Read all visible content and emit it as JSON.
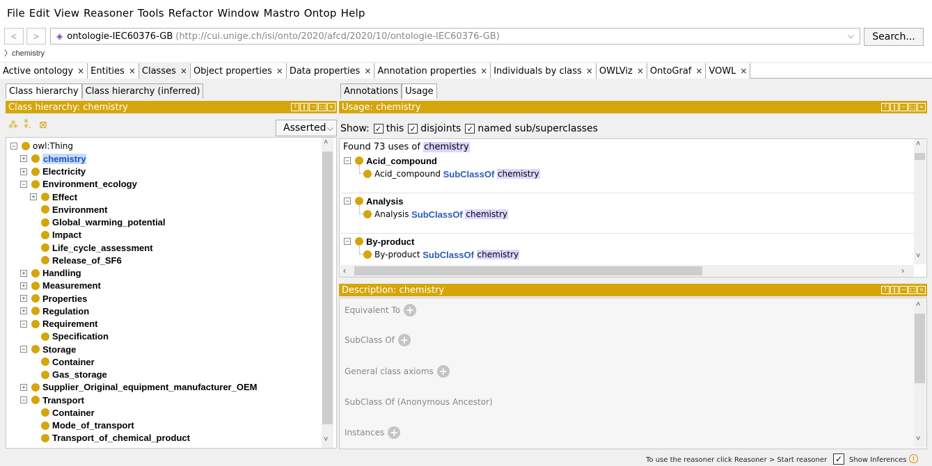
{
  "menu": [
    "File",
    "Edit",
    "View",
    "Reasoner",
    "Tools",
    "Refactor",
    "Window",
    "Mastro",
    "Ontop",
    "Help"
  ],
  "address": {
    "back": "<",
    "forward": ">",
    "ontology_name": "ontologie-IEC60376-GB",
    "iri": "(http://cui.unige.ch/isi/onto/2020/afcd/2020/10/ontologie-IEC60376-GB)",
    "search_label": "Search...",
    "breadcrumb": "chemistry"
  },
  "workspace_tabs": [
    {
      "label": "Active ontology"
    },
    {
      "label": "Entities"
    },
    {
      "label": "Classes"
    },
    {
      "label": "Object properties"
    },
    {
      "label": "Data properties"
    },
    {
      "label": "Annotation properties"
    },
    {
      "label": "Individuals by class"
    },
    {
      "label": "OWLViz"
    },
    {
      "label": "OntoGraf"
    },
    {
      "label": "VOWL"
    }
  ],
  "left_tabs": [
    "Class hierarchy",
    "Class hierarchy (inferred)"
  ],
  "class_hierarchy": {
    "header": "Class hierarchy: chemistry",
    "mode": "Asserted",
    "tree": [
      {
        "label": "owl:Thing",
        "level": 0,
        "exp": "minus",
        "bold": false
      },
      {
        "label": "chemistry",
        "level": 1,
        "exp": "plus",
        "bold": true,
        "selected": true
      },
      {
        "label": "Electricity",
        "level": 1,
        "exp": "plus",
        "bold": true
      },
      {
        "label": "Environment_ecology",
        "level": 1,
        "exp": "minus",
        "bold": true
      },
      {
        "label": "Effect",
        "level": 2,
        "exp": "plus",
        "bold": true
      },
      {
        "label": "Environment",
        "level": 2,
        "exp": "",
        "bold": true
      },
      {
        "label": "Global_warming_potential",
        "level": 2,
        "exp": "",
        "bold": true
      },
      {
        "label": "Impact",
        "level": 2,
        "exp": "",
        "bold": true
      },
      {
        "label": "Life_cycle_assessment",
        "level": 2,
        "exp": "",
        "bold": true
      },
      {
        "label": "Release_of_SF6",
        "level": 2,
        "exp": "",
        "bold": true
      },
      {
        "label": "Handling",
        "level": 1,
        "exp": "plus",
        "bold": true
      },
      {
        "label": "Measurement",
        "level": 1,
        "exp": "plus",
        "bold": true
      },
      {
        "label": "Properties",
        "level": 1,
        "exp": "plus",
        "bold": true
      },
      {
        "label": "Regulation",
        "level": 1,
        "exp": "plus",
        "bold": true
      },
      {
        "label": "Requirement",
        "level": 1,
        "exp": "minus",
        "bold": true
      },
      {
        "label": "Specification",
        "level": 2,
        "exp": "",
        "bold": true
      },
      {
        "label": "Storage",
        "level": 1,
        "exp": "minus",
        "bold": true
      },
      {
        "label": "Container",
        "level": 2,
        "exp": "",
        "bold": true
      },
      {
        "label": "Gas_storage",
        "level": 2,
        "exp": "",
        "bold": true
      },
      {
        "label": "Supplier_Original_equipment_manufacturer_OEM",
        "level": 1,
        "exp": "plus",
        "bold": true
      },
      {
        "label": "Transport",
        "level": 1,
        "exp": "minus",
        "bold": true
      },
      {
        "label": "Container",
        "level": 2,
        "exp": "",
        "bold": true
      },
      {
        "label": "Mode_of_transport",
        "level": 2,
        "exp": "",
        "bold": true
      },
      {
        "label": "Transport_of_chemical_product",
        "level": 2,
        "exp": "",
        "bold": true
      }
    ]
  },
  "right_tabs": [
    "Annotations",
    "Usage"
  ],
  "usage": {
    "header": "Usage: chemistry",
    "show_label": "Show:",
    "options": [
      {
        "label": "this",
        "checked": true
      },
      {
        "label": "disjoints",
        "checked": true
      },
      {
        "label": "named sub/superclasses",
        "checked": true
      }
    ],
    "found_prefix": "Found 73 uses of",
    "found_entity": "chemistry",
    "groups": [
      {
        "title": "Acid_compound",
        "subject": "Acid_compound",
        "keyword": "SubClassOf",
        "object": "chemistry"
      },
      {
        "title": "Analysis",
        "subject": "Analysis",
        "keyword": "SubClassOf",
        "object": "chemistry"
      },
      {
        "title": "By-product",
        "subject": "By-product",
        "keyword": "SubClassOf",
        "object": "chemistry"
      }
    ]
  },
  "description": {
    "header": "Description: chemistry",
    "sections": [
      {
        "label": "Equivalent To",
        "addable": true
      },
      {
        "label": "SubClass Of",
        "addable": true
      },
      {
        "label": "General class axioms",
        "addable": true
      },
      {
        "label": "SubClass Of (Anonymous Ancestor)",
        "addable": false
      },
      {
        "label": "Instances",
        "addable": true
      }
    ]
  },
  "status": {
    "message": "To use the reasoner click Reasoner > Start reasoner",
    "show_inferences": "Show Inferences",
    "show_inferences_checked": true
  },
  "colors": {
    "accent": "#d4a60c",
    "keyword": "#2a5db8",
    "highlight": "#dcd6ff"
  },
  "icons": [
    "diamond-icon",
    "add-subclass-icon",
    "add-sibling-icon",
    "delete-class-icon",
    "plus-icon",
    "warning-icon"
  ]
}
